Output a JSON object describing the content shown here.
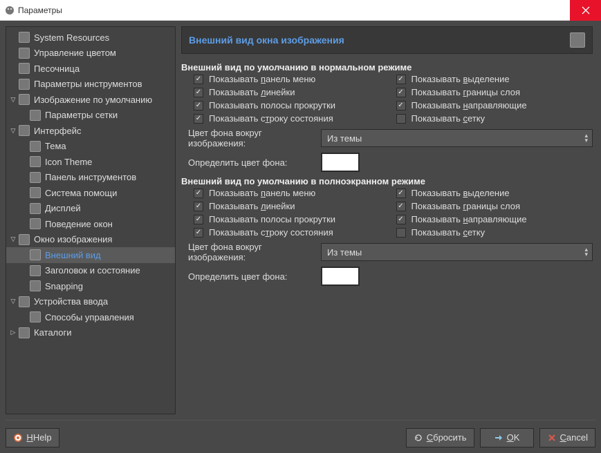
{
  "window": {
    "title": "Параметры"
  },
  "sidebar": {
    "items": [
      {
        "label": "System Resources",
        "indent": 1,
        "expander": ""
      },
      {
        "label": "Управление цветом",
        "indent": 1,
        "expander": ""
      },
      {
        "label": "Песочница",
        "indent": 1,
        "expander": ""
      },
      {
        "label": "Параметры инструментов",
        "indent": 1,
        "expander": ""
      },
      {
        "label": "Изображение по умолчанию",
        "indent": 1,
        "expander": "▽"
      },
      {
        "label": "Параметры сетки",
        "indent": 2,
        "expander": ""
      },
      {
        "label": "Интерфейс",
        "indent": 1,
        "expander": "▽"
      },
      {
        "label": "Тема",
        "indent": 2,
        "expander": ""
      },
      {
        "label": "Icon Theme",
        "indent": 2,
        "expander": ""
      },
      {
        "label": "Панель инструментов",
        "indent": 2,
        "expander": ""
      },
      {
        "label": "Система помощи",
        "indent": 2,
        "expander": ""
      },
      {
        "label": "Дисплей",
        "indent": 2,
        "expander": ""
      },
      {
        "label": "Поведение окон",
        "indent": 2,
        "expander": ""
      },
      {
        "label": "Окно изображения",
        "indent": 1,
        "expander": "▽"
      },
      {
        "label": "Внешний вид",
        "indent": 2,
        "expander": "",
        "selected": true
      },
      {
        "label": "Заголовок и состояние",
        "indent": 2,
        "expander": ""
      },
      {
        "label": "Snapping",
        "indent": 2,
        "expander": ""
      },
      {
        "label": "Устройства ввода",
        "indent": 1,
        "expander": "▽"
      },
      {
        "label": "Способы управления",
        "indent": 2,
        "expander": ""
      },
      {
        "label": "Каталоги",
        "indent": 1,
        "expander": "▷"
      }
    ]
  },
  "page": {
    "title": "Внешний вид окна изображения",
    "sections": [
      {
        "title": "Внешний вид по умолчанию в нормальном режиме",
        "checks_left": [
          {
            "label_pre": "Показывать ",
            "u": "п",
            "label_post": "анель меню",
            "checked": true
          },
          {
            "label_pre": "Показывать ",
            "u": "л",
            "label_post": "инейки",
            "checked": true
          },
          {
            "label_pre": "Показывать полосы прокрутки",
            "u": "",
            "label_post": "",
            "checked": true
          },
          {
            "label_pre": "Показывать с",
            "u": "т",
            "label_post": "року состояния",
            "checked": true
          }
        ],
        "checks_right": [
          {
            "label_pre": "Показывать ",
            "u": "в",
            "label_post": "ыделение",
            "checked": true
          },
          {
            "label_pre": "Показывать ",
            "u": "г",
            "label_post": "раницы слоя",
            "checked": true
          },
          {
            "label_pre": "Показывать ",
            "u": "н",
            "label_post": "аправляющие",
            "checked": true
          },
          {
            "label_pre": "Показывать ",
            "u": "с",
            "label_post": "етку",
            "checked": false
          }
        ],
        "combo_label": "Цвет фона вокруг изображения:",
        "combo_value": "Из темы",
        "color_label": "Определить цвет фона:",
        "color_value": "#ffffff"
      },
      {
        "title": "Внешний вид по умолчанию в полноэкранном режиме",
        "checks_left": [
          {
            "label_pre": "Показывать ",
            "u": "п",
            "label_post": "анель меню",
            "checked": true
          },
          {
            "label_pre": "Показывать ",
            "u": "л",
            "label_post": "инейки",
            "checked": true
          },
          {
            "label_pre": "Показывать полосы прокрутки",
            "u": "",
            "label_post": "",
            "checked": true
          },
          {
            "label_pre": "Показывать с",
            "u": "т",
            "label_post": "року состояния",
            "checked": true
          }
        ],
        "checks_right": [
          {
            "label_pre": "Показывать ",
            "u": "в",
            "label_post": "ыделение",
            "checked": true
          },
          {
            "label_pre": "Показывать ",
            "u": "г",
            "label_post": "раницы слоя",
            "checked": true
          },
          {
            "label_pre": "Показывать ",
            "u": "н",
            "label_post": "аправляющие",
            "checked": true
          },
          {
            "label_pre": "Показывать ",
            "u": "с",
            "label_post": "етку",
            "checked": false
          }
        ],
        "combo_label": "Цвет фона вокруг изображения:",
        "combo_value": "Из темы",
        "color_label": "Определить цвет фона:",
        "color_value": "#ffffff"
      }
    ]
  },
  "footer": {
    "help": "Help",
    "help_u": "H",
    "reset": "бросить",
    "reset_u": "С",
    "ok": "K",
    "ok_u": "O",
    "cancel": "ancel",
    "cancel_u": "C"
  }
}
